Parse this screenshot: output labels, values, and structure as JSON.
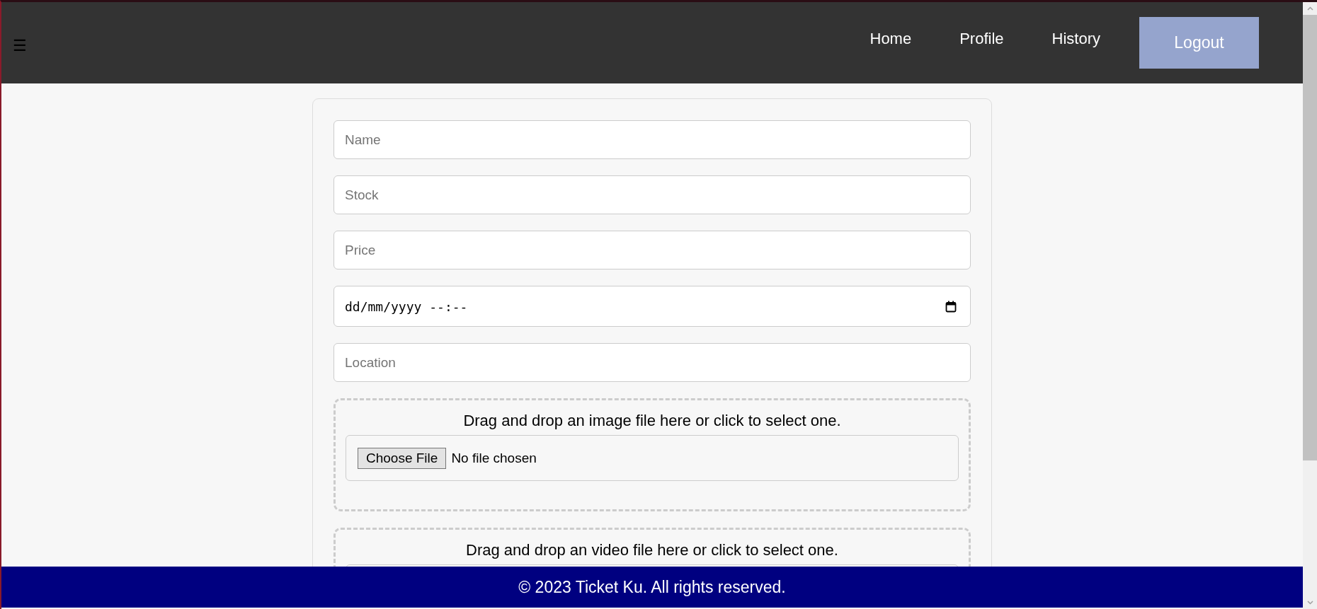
{
  "header": {
    "menu_icon": "☰",
    "nav": [
      {
        "label": "Home",
        "kind": "link"
      },
      {
        "label": "Profile",
        "kind": "link"
      },
      {
        "label": "History",
        "kind": "link"
      },
      {
        "label": "Logout",
        "kind": "button"
      }
    ]
  },
  "form": {
    "fields": [
      {
        "kind": "text",
        "placeholder": "Name"
      },
      {
        "kind": "text",
        "placeholder": "Stock"
      },
      {
        "kind": "text",
        "placeholder": "Price"
      },
      {
        "kind": "datetime",
        "value": "dd/mm/yyyy --:--"
      },
      {
        "kind": "text",
        "placeholder": "Location"
      }
    ],
    "dropzones": [
      {
        "text": "Drag and drop an image file here or click to select one.",
        "file_button": "Choose File",
        "file_status": "No file chosen"
      },
      {
        "text": "Drag and drop an video file here or click to select one."
      }
    ]
  },
  "footer": {
    "text": "© 2023 Ticket Ku. All rights reserved."
  }
}
